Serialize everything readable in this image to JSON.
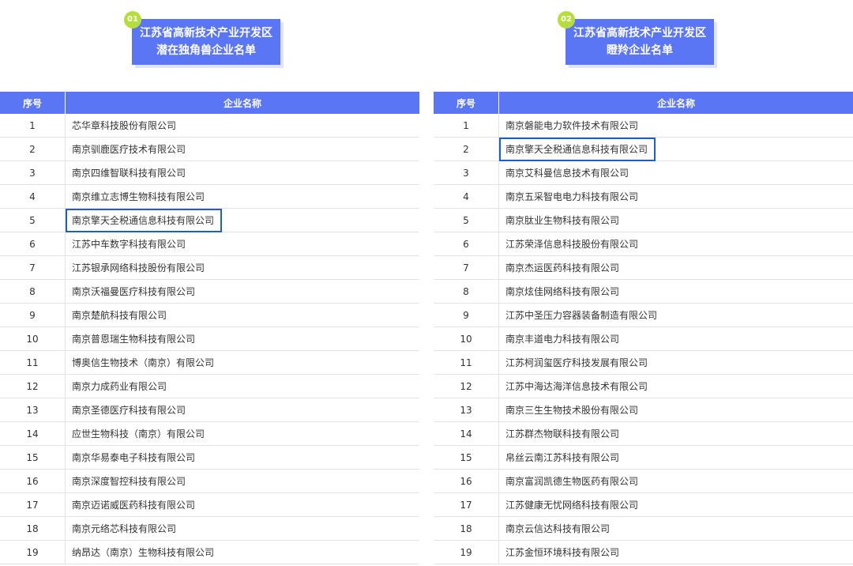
{
  "left": {
    "badge": "01",
    "title_line1": "江苏省高新技术产业开发区",
    "title_line2": "潜在独角兽企业名单",
    "headers": {
      "num": "序号",
      "name": "企业名称"
    },
    "rows": [
      {
        "num": "1",
        "name": "芯华章科技股份有限公司"
      },
      {
        "num": "2",
        "name": "南京驯鹿医疗技术有限公司"
      },
      {
        "num": "3",
        "name": "南京四维智联科技有限公司"
      },
      {
        "num": "4",
        "name": "南京维立志博生物科技有限公司"
      },
      {
        "num": "5",
        "name": "南京擎天全税通信息科技有限公司",
        "highlighted": true
      },
      {
        "num": "6",
        "name": "江苏中车数字科技有限公司"
      },
      {
        "num": "7",
        "name": "江苏银承网络科技股份有限公司"
      },
      {
        "num": "8",
        "name": "南京沃福曼医疗科技有限公司"
      },
      {
        "num": "9",
        "name": "南京楚航科技有限公司"
      },
      {
        "num": "10",
        "name": "南京普恩瑞生物科技有限公司"
      },
      {
        "num": "11",
        "name": "博奥信生物技术（南京）有限公司"
      },
      {
        "num": "12",
        "name": "南京力成药业有限公司"
      },
      {
        "num": "13",
        "name": "南京圣德医疗科技有限公司"
      },
      {
        "num": "14",
        "name": "应世生物科技（南京）有限公司"
      },
      {
        "num": "15",
        "name": "南京华易泰电子科技有限公司"
      },
      {
        "num": "16",
        "name": "南京深度智控科技有限公司"
      },
      {
        "num": "17",
        "name": "南京迈诺威医药科技有限公司"
      },
      {
        "num": "18",
        "name": "南京元络芯科技有限公司"
      },
      {
        "num": "19",
        "name": "纳昂达（南京）生物科技有限公司"
      }
    ]
  },
  "right": {
    "badge": "02",
    "title_line1": "江苏省高新技术产业开发区",
    "title_line2": "瞪羚企业名单",
    "headers": {
      "num": "序号",
      "name": "企业名称"
    },
    "rows": [
      {
        "num": "1",
        "name": "南京磐能电力软件技术有限公司"
      },
      {
        "num": "2",
        "name": "南京擎天全税通信息科技有限公司",
        "highlighted": true
      },
      {
        "num": "3",
        "name": "南京艾科曼信息技术有限公司"
      },
      {
        "num": "4",
        "name": "南京五采智电电力科技有限公司"
      },
      {
        "num": "5",
        "name": "南京肽业生物科技有限公司"
      },
      {
        "num": "6",
        "name": "江苏荣泽信息科技股份有限公司"
      },
      {
        "num": "7",
        "name": "南京杰运医药科技有限公司"
      },
      {
        "num": "8",
        "name": "南京炫佳网络科技有限公司"
      },
      {
        "num": "9",
        "name": "江苏中圣压力容器装备制造有限公司"
      },
      {
        "num": "10",
        "name": "南京丰道电力科技有限公司"
      },
      {
        "num": "11",
        "name": "江苏柯润玺医疗科技发展有限公司"
      },
      {
        "num": "12",
        "name": "江苏中海达海洋信息技术有限公司"
      },
      {
        "num": "13",
        "name": "南京三生生物技术股份有限公司"
      },
      {
        "num": "14",
        "name": "江苏群杰物联科技有限公司"
      },
      {
        "num": "15",
        "name": "帛丝云南江苏科技有限公司"
      },
      {
        "num": "16",
        "name": "南京富润凯德生物医药有限公司"
      },
      {
        "num": "17",
        "name": "江苏健康无忧网络科技有限公司"
      },
      {
        "num": "18",
        "name": "南京云信达科技有限公司"
      },
      {
        "num": "19",
        "name": "江苏金恒环境科技有限公司"
      }
    ]
  },
  "colors": {
    "accent": "#5b76f5",
    "badge": "#b5dd3c",
    "highlight_border": "#1f5fbf",
    "title_shadow": "#dfe3ff"
  }
}
